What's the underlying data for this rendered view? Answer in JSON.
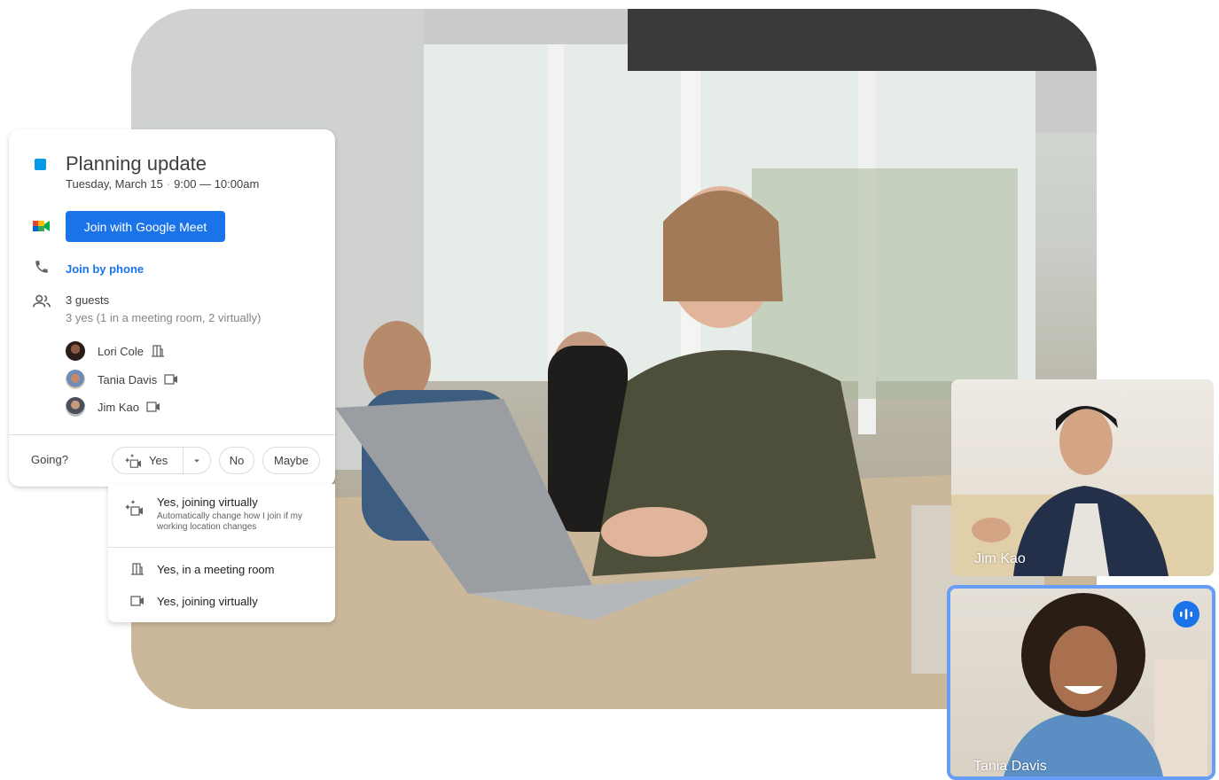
{
  "event": {
    "title": "Planning update",
    "date": "Tuesday, March 15",
    "time": "9:00 — 10:00am",
    "color": "#039be5"
  },
  "actions": {
    "join_meet_label": "Join with Google Meet",
    "join_phone_label": "Join by phone"
  },
  "guests": {
    "count_label": "3 guests",
    "summary": "3 yes (1 in a meeting room, 2 virtually)",
    "list": [
      {
        "name": "Lori Cole",
        "mode_icon": "meeting-room-icon"
      },
      {
        "name": "Tania Davis",
        "mode_icon": "video-camera-icon"
      },
      {
        "name": "Jim Kao",
        "mode_icon": "video-camera-icon"
      }
    ]
  },
  "rsvp": {
    "label": "Going?",
    "yes": "Yes",
    "no": "No",
    "maybe": "Maybe"
  },
  "rsvp_menu": {
    "option_auto_title": "Yes, joining virtually",
    "option_auto_desc": "Automatically change how I join if my working location changes",
    "option_room": "Yes, in a meeting room",
    "option_virtual": "Yes, joining virtually"
  },
  "video_tiles": {
    "tile1_name": "Jim Kao",
    "tile2_name": "Tania Davis"
  },
  "colors": {
    "accent": "#1a73e8",
    "active_speaker_border": "#669df6"
  }
}
